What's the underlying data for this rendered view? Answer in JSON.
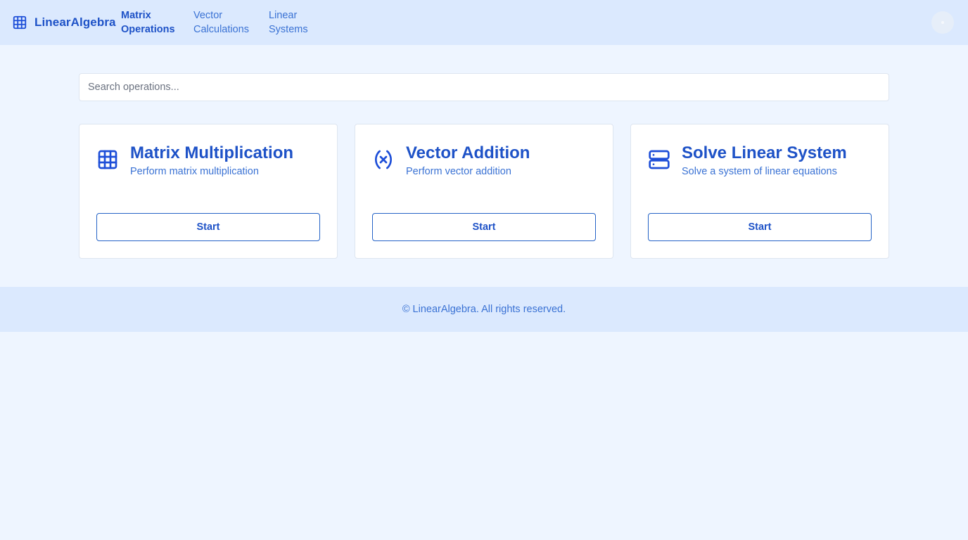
{
  "header": {
    "brand": {
      "name": "LinearAlgebra",
      "icon": "grid-icon"
    },
    "nav": [
      {
        "label": "Matrix\nOperations",
        "active": true
      },
      {
        "label": "Vector\nCalculations",
        "active": false
      },
      {
        "label": "Linear\nSystems",
        "active": false
      }
    ]
  },
  "search": {
    "placeholder": "Search operations..."
  },
  "cards": [
    {
      "title": "Matrix Multiplication",
      "description": "Perform matrix multiplication",
      "button": "Start",
      "icon": "grid-icon"
    },
    {
      "title": "Vector Addition",
      "description": "Perform vector addition",
      "button": "Start",
      "icon": "variable-icon"
    },
    {
      "title": "Solve Linear System",
      "description": "Solve a system of linear equations",
      "button": "Start",
      "icon": "server-icon"
    }
  ],
  "footer": {
    "text": "© LinearAlgebra. All rights reserved."
  },
  "colors": {
    "accent": "#1e52c7",
    "link": "#3a72d4",
    "header_bg": "#dbe9fe",
    "page_bg": "#eef5ff"
  }
}
